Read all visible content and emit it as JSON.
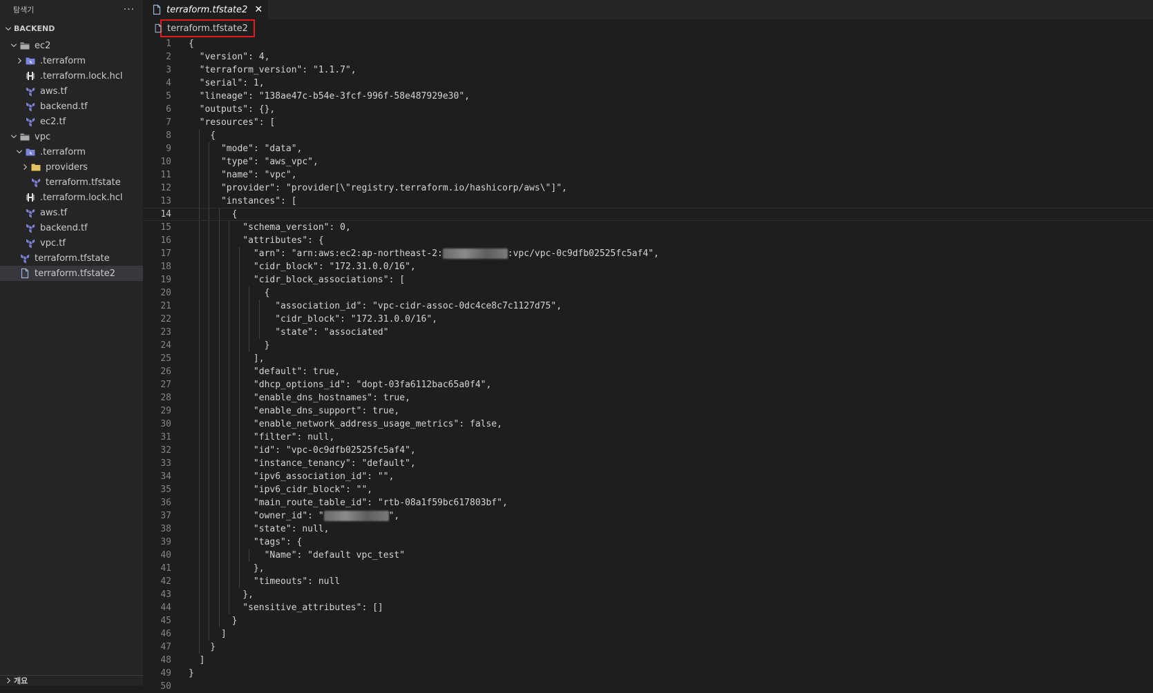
{
  "explorer": {
    "title": "탐색기",
    "more_label": "···",
    "section_title": "BACKEND",
    "outline_title": "개요",
    "tree": [
      {
        "label": "ec2",
        "type": "folder-open",
        "depth": 1,
        "chevron": "down"
      },
      {
        "label": ".terraform",
        "type": "folder-special",
        "depth": 2,
        "chevron": "right"
      },
      {
        "label": ".terraform.lock.hcl",
        "type": "hcl",
        "depth": 2,
        "chevron": ""
      },
      {
        "label": "aws.tf",
        "type": "terraform",
        "depth": 2,
        "chevron": ""
      },
      {
        "label": "backend.tf",
        "type": "terraform",
        "depth": 2,
        "chevron": ""
      },
      {
        "label": "ec2.tf",
        "type": "terraform",
        "depth": 2,
        "chevron": ""
      },
      {
        "label": "vpc",
        "type": "folder-open",
        "depth": 1,
        "chevron": "down"
      },
      {
        "label": ".terraform",
        "type": "folder-special",
        "depth": 2,
        "chevron": "down"
      },
      {
        "label": "providers",
        "type": "folder-yellow",
        "depth": 3,
        "chevron": "right"
      },
      {
        "label": "terraform.tfstate",
        "type": "terraform",
        "depth": 3,
        "chevron": ""
      },
      {
        "label": ".terraform.lock.hcl",
        "type": "hcl",
        "depth": 2,
        "chevron": ""
      },
      {
        "label": "aws.tf",
        "type": "terraform",
        "depth": 2,
        "chevron": ""
      },
      {
        "label": "backend.tf",
        "type": "terraform",
        "depth": 2,
        "chevron": ""
      },
      {
        "label": "vpc.tf",
        "type": "terraform",
        "depth": 2,
        "chevron": ""
      },
      {
        "label": "terraform.tfstate",
        "type": "terraform",
        "depth": 1,
        "chevron": ""
      },
      {
        "label": "terraform.tfstate2",
        "type": "file",
        "depth": 1,
        "chevron": "",
        "selected": true
      }
    ]
  },
  "editor": {
    "tab_label": "terraform.tfstate2",
    "breadcrumb": "terraform.tfstate2",
    "current_line": 14,
    "lines": [
      "{",
      "  \"version\": 4,",
      "  \"terraform_version\": \"1.1.7\",",
      "  \"serial\": 1,",
      "  \"lineage\": \"138ae47c-b54e-3fcf-996f-58e487929e30\",",
      "  \"outputs\": {},",
      "  \"resources\": [",
      "    {",
      "      \"mode\": \"data\",",
      "      \"type\": \"aws_vpc\",",
      "      \"name\": \"vpc\",",
      "      \"provider\": \"provider[\\\"registry.terraform.io/hashicorp/aws\\\"]\",",
      "      \"instances\": [",
      "        {",
      "          \"schema_version\": 0,",
      "          \"attributes\": {",
      "            \"arn\": \"arn:aws:ec2:ap-northeast-2:[REDACTED]:vpc/vpc-0c9dfb02525fc5af4\",",
      "            \"cidr_block\": \"172.31.0.0/16\",",
      "            \"cidr_block_associations\": [",
      "              {",
      "                \"association_id\": \"vpc-cidr-assoc-0dc4ce8c7c1127d75\",",
      "                \"cidr_block\": \"172.31.0.0/16\",",
      "                \"state\": \"associated\"",
      "              }",
      "            ],",
      "            \"default\": true,",
      "            \"dhcp_options_id\": \"dopt-03fa6112bac65a0f4\",",
      "            \"enable_dns_hostnames\": true,",
      "            \"enable_dns_support\": true,",
      "            \"enable_network_address_usage_metrics\": false,",
      "            \"filter\": null,",
      "            \"id\": \"vpc-0c9dfb02525fc5af4\",",
      "            \"instance_tenancy\": \"default\",",
      "            \"ipv6_association_id\": \"\",",
      "            \"ipv6_cidr_block\": \"\",",
      "            \"main_route_table_id\": \"rtb-08a1f59bc617803bf\",",
      "            \"owner_id\": \"[REDACTED]\",",
      "            \"state\": null,",
      "            \"tags\": {",
      "              \"Name\": \"default vpc_test\"",
      "            },",
      "            \"timeouts\": null",
      "          },",
      "          \"sensitive_attributes\": []",
      "        }",
      "      ]",
      "    }",
      "  ]",
      "}",
      ""
    ]
  }
}
